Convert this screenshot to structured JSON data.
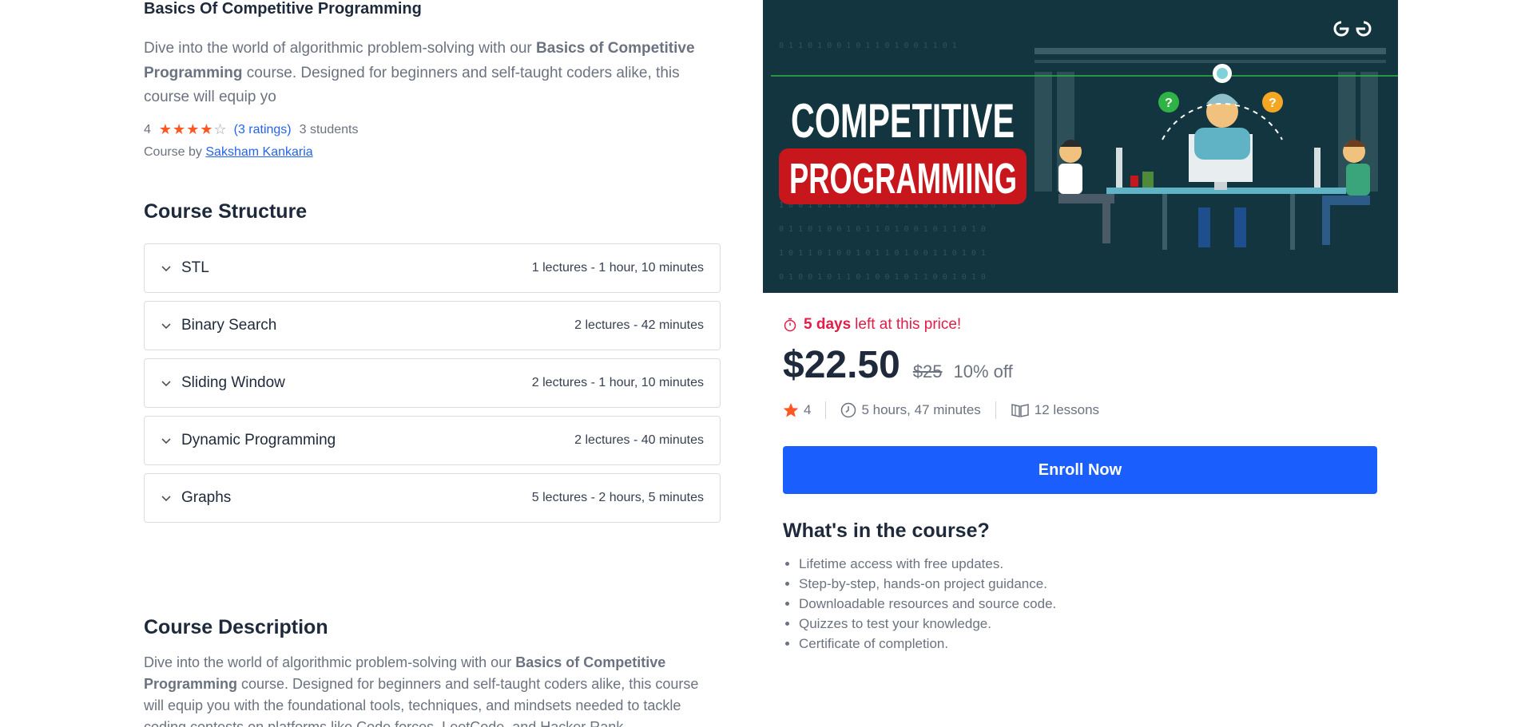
{
  "course": {
    "title": "Basics Of Competitive Programming",
    "intro_prefix": "Dive into the world of algorithmic problem-solving with our ",
    "intro_bold": "Basics of Competitive Programming",
    "intro_suffix": " course. Designed for beginners and self-taught coders alike, this course will equip yo",
    "rating_value": "4",
    "rating_stars": 4,
    "rating_max": 5,
    "ratings_link": "(3 ratings)",
    "students": "3 students",
    "by_label": "Course by",
    "author": "Saksham Kankaria"
  },
  "structure": {
    "heading": "Course Structure",
    "sections": [
      {
        "label": "STL",
        "info": "1 lectures - 1 hour, 10 minutes"
      },
      {
        "label": "Binary Search",
        "info": "2 lectures - 42 minutes"
      },
      {
        "label": "Sliding Window",
        "info": "2 lectures - 1 hour, 10 minutes"
      },
      {
        "label": "Dynamic Programming",
        "info": "2 lectures - 40 minutes"
      },
      {
        "label": "Graphs",
        "info": "5 lectures - 2 hours, 5 minutes"
      }
    ]
  },
  "description": {
    "heading": "Course Description",
    "prefix": "Dive into the world of algorithmic problem-solving with our ",
    "bold": "Basics of Competitive Programming",
    "suffix": " course. Designed for beginners and self-taught coders alike, this course will equip you with the foundational tools, techniques, and mindsets needed to tackle coding contests on platforms like Code forces, LeetCode, and Hacker Rank."
  },
  "banner": {
    "line1": "COMPETITIVE",
    "line2": "PROGRAMMING",
    "logo_icon": "gfg-logo-icon",
    "colors": {
      "background": "#133540",
      "badge": "#c8161d",
      "accent": "#2fb344"
    }
  },
  "pricing": {
    "urgency_bold": "5 days",
    "urgency_rest": "left at this price!",
    "price": "$22.50",
    "old_price": "$25",
    "discount": "10% off",
    "stats_rating": "4",
    "duration": "5 hours, 47 minutes",
    "lessons": "12 lessons",
    "enroll_label": "Enroll Now",
    "colors": {
      "urgency": "#e11d48",
      "button": "#1a5ffe",
      "star": "#ff5722"
    }
  },
  "includes": {
    "heading": "What's in the course?",
    "items": [
      "Lifetime access with free updates.",
      "Step-by-step, hands-on project guidance.",
      "Downloadable resources and source code.",
      "Quizzes to test your knowledge.",
      "Certificate of completion."
    ]
  }
}
